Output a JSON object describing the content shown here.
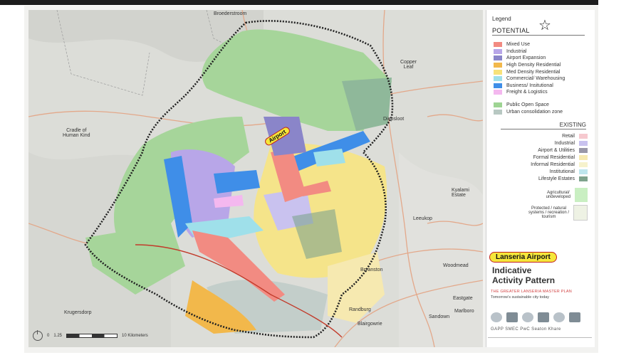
{
  "map": {
    "places": {
      "broederstroom": "Broederstroom",
      "copper_leaf": "Copper\nLeaf",
      "cradle": "Cradle of\nHuman Kind",
      "diepsloot": "Diepsloot",
      "kyalami": "Kyalami\nEstate",
      "leeukop": "Leeukop",
      "bryanston": "Bryanston",
      "woodmead": "Woodmead",
      "randburg": "Randburg",
      "eastgate": "Eastgate",
      "sandown": "Sandown",
      "marlboro": "Marlboro",
      "blairgowrie": "Blairgowrie",
      "krugersdorp": "Krugersdorp"
    },
    "airport_tag": "Airport",
    "scale": {
      "start": "0",
      "mid": "1.25",
      "end": "10 Kilometers"
    }
  },
  "legend": {
    "title": "Legend",
    "potential_heading": "POTENTIAL",
    "potential_items": [
      {
        "label": "Mixed Use",
        "color": "#f28b82"
      },
      {
        "label": "Industrial",
        "color": "#b8a6e8"
      },
      {
        "label": "Airport Expansion",
        "color": "#8a85c9"
      },
      {
        "label": "High Density Residential",
        "color": "#f2b84b"
      },
      {
        "label": "Med Density Residential",
        "color": "#f7e27a"
      },
      {
        "label": "Commercial/ Warehousing",
        "color": "#9fe0ea"
      },
      {
        "label": "Business/ Insitutional",
        "color": "#3f8ee8"
      },
      {
        "label": "Freight & Logistics",
        "color": "#f4b8ef"
      }
    ],
    "open_items": [
      {
        "label": "Public Open Space",
        "color": "#9ed493"
      },
      {
        "label": "Urban consolidation zone",
        "color": "#b8c8c2"
      }
    ],
    "existing_heading": "EXISTING",
    "existing_items": [
      {
        "label": "Retail",
        "color": "#f6c9cf"
      },
      {
        "label": "Industrial",
        "color": "#c9c2ef"
      },
      {
        "label": "Airport & Utilities",
        "color": "#9a98a8"
      },
      {
        "label": "Formal Residential",
        "color": "#f6e9b0"
      },
      {
        "label": "Informal Residential",
        "color": "#f6f2cc"
      },
      {
        "label": "Institutional",
        "color": "#bfe6ee"
      },
      {
        "label": "Lifestyle Estates",
        "color": "#7fa38d"
      }
    ],
    "agricultural": {
      "label": "Agricultural/\nundeveloped",
      "color": "#c9efc2"
    },
    "protected": {
      "label": "Protected / natural\nsystems / recreation /\ntourism",
      "color": "#eef2e4"
    },
    "airport_label": "Lanseria Airport",
    "map_title": "Indicative\nActivity Pattern",
    "plan_name": "THE GREATER LANSERIA MASTER PLAN",
    "tagline": "Tomorrow's sustainable city today",
    "partners": "GAPP  SMEC  PwC  Seaton  Khare"
  }
}
